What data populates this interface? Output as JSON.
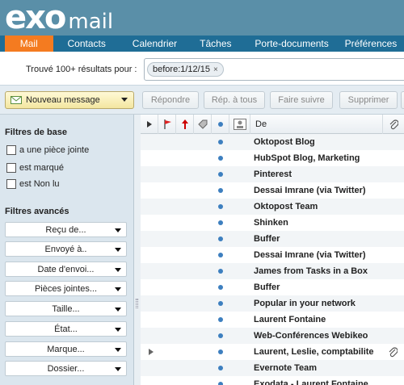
{
  "app": {
    "logo_main": "exo",
    "logo_sub": "mail"
  },
  "nav": {
    "items": [
      {
        "label": "Mail",
        "active": true
      },
      {
        "label": "Contacts",
        "active": false
      },
      {
        "label": "Calendrier",
        "active": false
      },
      {
        "label": "Tâches",
        "active": false
      },
      {
        "label": "Porte-documents",
        "active": false
      },
      {
        "label": "Préférences",
        "active": false
      }
    ]
  },
  "search": {
    "results_label": "Trouvé 100+ résultats pour :",
    "tag": "before:1/12/15",
    "tag_remove": "×"
  },
  "toolbar": {
    "new_message": "Nouveau message",
    "buttons": [
      "Répondre",
      "Rép. à tous",
      "Faire suivre",
      "Supprimer"
    ]
  },
  "filters": {
    "basic_title": "Filtres de base",
    "basic": [
      "a une pièce jointe",
      "est marqué",
      "est Non lu"
    ],
    "advanced_title": "Filtres avancés",
    "advanced": [
      "Reçu de...",
      "Envoyé à..",
      "Date d'envoi...",
      "Pièces jointes...",
      "Taille...",
      "État...",
      "Marque...",
      "Dossier..."
    ]
  },
  "list": {
    "from_header": "De",
    "rows": [
      {
        "from": "Oktopost Blog",
        "expand": false,
        "attachment": false
      },
      {
        "from": "HubSpot Blog, Marketing",
        "expand": false,
        "attachment": false
      },
      {
        "from": "Pinterest",
        "expand": false,
        "attachment": false
      },
      {
        "from": "Dessai Imrane (via Twitter)",
        "expand": false,
        "attachment": false
      },
      {
        "from": "Oktopost Team",
        "expand": false,
        "attachment": false
      },
      {
        "from": "Shinken",
        "expand": false,
        "attachment": false
      },
      {
        "from": "Buffer",
        "expand": false,
        "attachment": false
      },
      {
        "from": "Dessai Imrane (via Twitter)",
        "expand": false,
        "attachment": false
      },
      {
        "from": "James from Tasks in a Box",
        "expand": false,
        "attachment": false
      },
      {
        "from": "Buffer",
        "expand": false,
        "attachment": false
      },
      {
        "from": "Popular in your network",
        "expand": false,
        "attachment": false
      },
      {
        "from": "Laurent Fontaine",
        "expand": false,
        "attachment": false
      },
      {
        "from": "Web-Conférences Webikeo",
        "expand": false,
        "attachment": false
      },
      {
        "from": "Laurent, Leslie, comptabilite",
        "expand": true,
        "attachment": true
      },
      {
        "from": "Evernote Team",
        "expand": false,
        "attachment": false
      },
      {
        "from": "Exodata - Laurent Fontaine",
        "expand": false,
        "attachment": false
      }
    ]
  },
  "colors": {
    "header": "#5a8fa8",
    "nav": "#1f6d96",
    "nav_active": "#f47b20",
    "unread_dot": "#3d7fbf"
  }
}
